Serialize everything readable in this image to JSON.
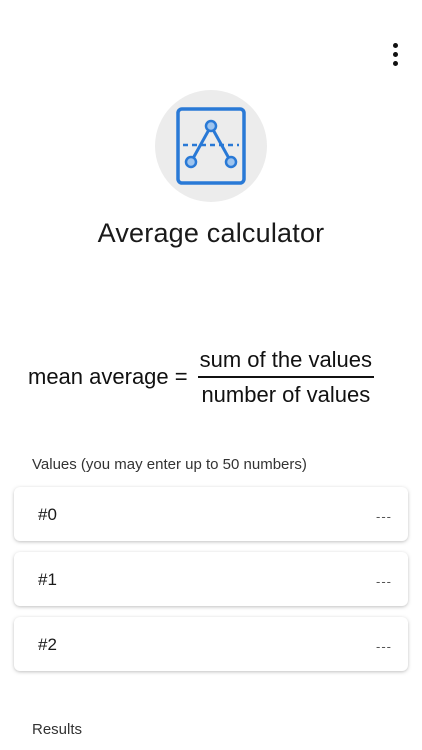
{
  "header": {
    "menu_icon": "more-vert-icon"
  },
  "hero": {
    "icon": "mean-chart-icon",
    "accent": "#2979d6",
    "title": "Average calculator"
  },
  "formula": {
    "lhs": "mean average =",
    "numerator": "sum of the values",
    "denominator": "number of values"
  },
  "values": {
    "label": "Values (you may enter up to 50 numbers)",
    "items": [
      {
        "index": "#0",
        "placeholder": "---"
      },
      {
        "index": "#1",
        "placeholder": "---"
      },
      {
        "index": "#2",
        "placeholder": "---"
      }
    ]
  },
  "results": {
    "label": "Results"
  }
}
